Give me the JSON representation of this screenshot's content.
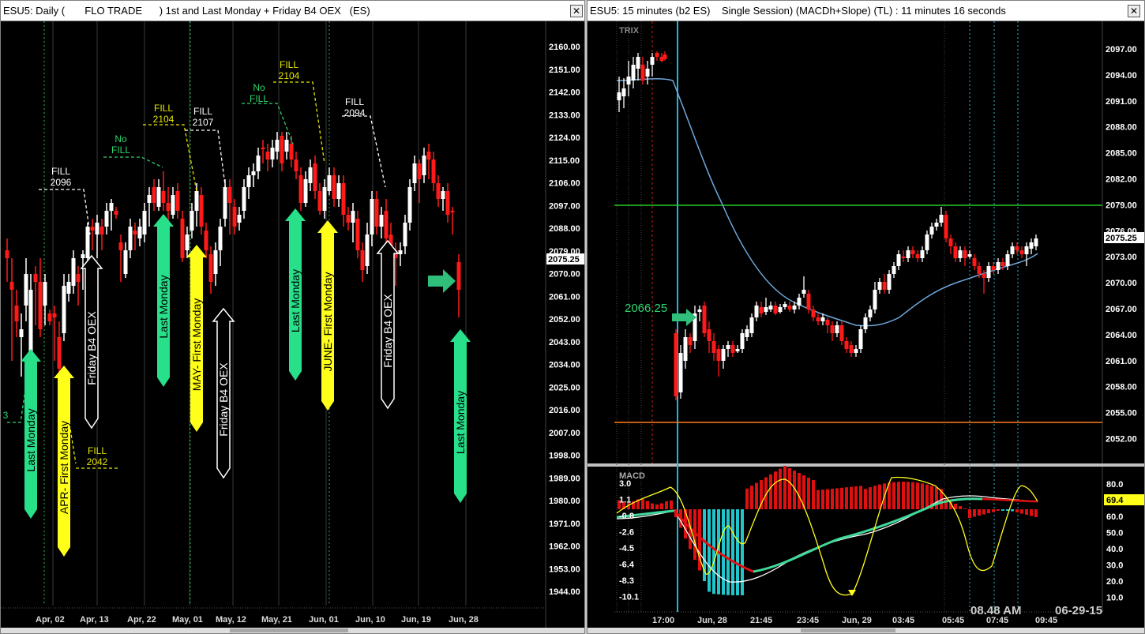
{
  "left_window": {
    "title": "ESU5: Daily (       FLO TRADE      ) 1st and Last Monday + Friday B4 OEX   (ES)",
    "close_label": "✕",
    "price_labels": [
      "2160.00",
      "2151.00",
      "2142.00",
      "2133.00",
      "2124.00",
      "2115.00",
      "2106.00",
      "2097.00",
      "2088.00",
      "2079.00",
      "2070.00",
      "2061.00",
      "2052.00",
      "2043.00",
      "2034.00",
      "2025.00",
      "2016.00",
      "2007.00",
      "1998.00",
      "1989.00",
      "1980.00",
      "1971.00",
      "1962.00",
      "1953.00",
      "1944.00"
    ],
    "last_price": "2075.25",
    "date_labels": [
      "Apr, 02",
      "Apr, 13",
      "Apr, 22",
      "May, 01",
      "May, 12",
      "May, 21",
      "Jun, 01",
      "Jun, 10",
      "Jun, 19",
      "Jun, 28"
    ],
    "arrow_labels": [
      "Last Monday",
      "APR- First Monday",
      "Friday B4 OEX",
      "Last Monday",
      "MAY- First Monday",
      "Friday B4 OEX",
      "Last Monday",
      "JUNE- First Monday",
      "Friday B4 OEX",
      "Last Monday"
    ],
    "fill_notes": [
      {
        "line1": "FILL",
        "line2": "2096"
      },
      {
        "line1": "No",
        "line2": "FILL"
      },
      {
        "line1": "FILL",
        "line2": "2104"
      },
      {
        "line1": "FILL",
        "line2": "2107"
      },
      {
        "line1": "No",
        "line2": "FILL"
      },
      {
        "line1": "FILL",
        "line2": "2104"
      },
      {
        "line1": "FILL",
        "line2": "2094"
      },
      {
        "line1": "FILL",
        "line2": "2042"
      }
    ],
    "edge_label": "3"
  },
  "right_window": {
    "title": "ESU5: 15 minutes (b2 ES)    Single Session) (MACDh+Slope) (TL) : 11 minutes 16 seconds",
    "close_label": "✕",
    "trix_label": "TRIX",
    "macd_label": "MACD",
    "price_labels": [
      "2097.00",
      "2094.00",
      "2091.00",
      "2088.00",
      "2085.00",
      "2082.00",
      "2079.00",
      "2076.00",
      "2073.00",
      "2070.00",
      "2067.00",
      "2064.00",
      "2061.00",
      "2058.00",
      "2055.00",
      "2052.00"
    ],
    "last_price": "2075.25",
    "entry_label": "2066.25",
    "macd_left_labels": [
      "3.0",
      "1.1",
      "-0.8",
      "-2.6",
      "-4.5",
      "-6.4",
      "-8.3",
      "-10.1"
    ],
    "macd_right_labels": [
      "80.0",
      "70.0",
      "60.0",
      "50.0",
      "40.0",
      "30.0",
      "20.0",
      "10.0"
    ],
    "macd_current": "69.4",
    "time_labels": [
      "17:00",
      "Jun, 28",
      "21:45",
      "23:45",
      "Jun, 29",
      "03:45",
      "05:45",
      "07:45",
      "09:45"
    ],
    "clock_time": "08.48 AM",
    "clock_date": "06-29-15"
  },
  "colors": {
    "up_candle": "#ffffff",
    "down_candle": "#ff1a1a",
    "green_arrow": "#28e08a",
    "yellow_arrow": "#ffff1a",
    "fill_yellow": "#e6e600",
    "trix_line": "#6fa8dc",
    "resistance": "#22cc22",
    "support": "#ff7a1a",
    "session_line": "#1fb8e0",
    "macd_hist_up": "#e01010",
    "macd_hist_down": "#21c5cc"
  }
}
